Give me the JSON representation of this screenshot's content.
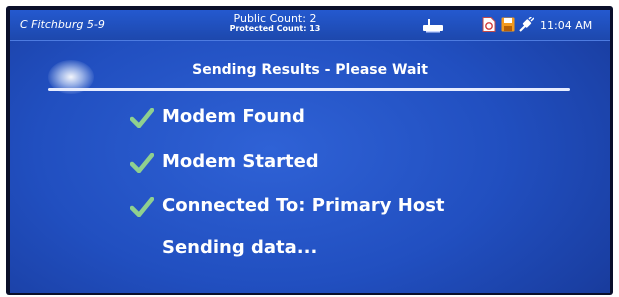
{
  "statusbar": {
    "precinct": "C Fitchburg 5-9",
    "public_count": "Public Count: 2",
    "protected_count": "Protected Count: 13",
    "clock": "11:04 AM",
    "icons": [
      "printer-icon",
      "document-icon",
      "save-disk-icon",
      "plug-icon"
    ]
  },
  "dialog": {
    "title": "Sending Results - Please Wait",
    "steps": [
      {
        "label": "Modem Found",
        "done": true
      },
      {
        "label": "Modem Started",
        "done": true
      },
      {
        "label": "Connected To: Primary Host",
        "done": true
      },
      {
        "label": "Sending data...",
        "done": false
      }
    ]
  },
  "colors": {
    "screen_background": "#214fc0",
    "statusbar_background": "#1d48ad",
    "check_mark": "#8fd08f",
    "text": "#ffffff"
  }
}
